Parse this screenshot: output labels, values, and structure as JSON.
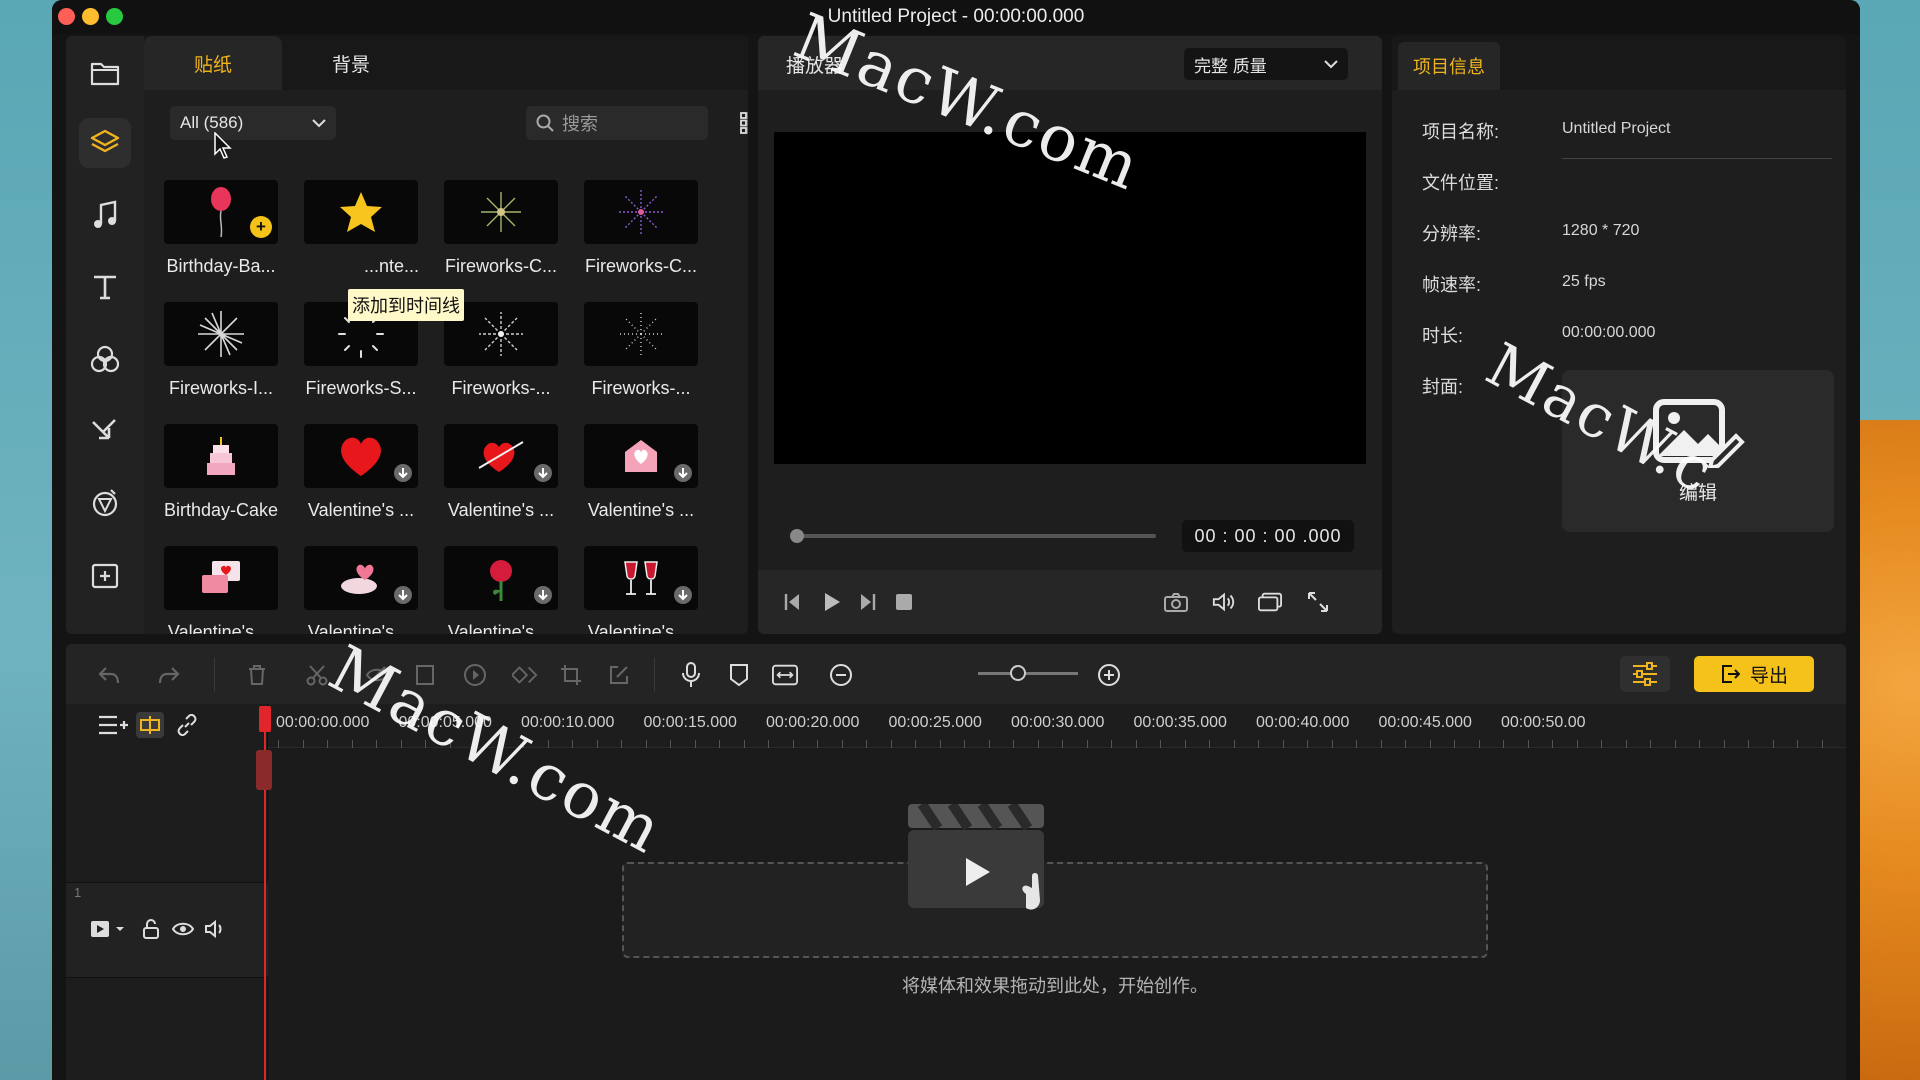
{
  "window": {
    "title": "Untitled Project - 00:00:00.000"
  },
  "sticker_panel": {
    "tabs": [
      {
        "label": "贴纸",
        "active": true
      },
      {
        "label": "背景",
        "active": false
      }
    ],
    "filter_value": "All (586)",
    "search_placeholder": "搜索",
    "tooltip": "添加到时间线",
    "items": [
      {
        "label": "Birthday-Ba...",
        "icon": "balloon",
        "badge": "add"
      },
      {
        "label": "...nte...",
        "icon": "star",
        "badge": ""
      },
      {
        "label": "Fireworks-C...",
        "icon": "firework-green",
        "badge": ""
      },
      {
        "label": "Fireworks-C...",
        "icon": "firework-purple",
        "badge": ""
      },
      {
        "label": "Fireworks-I...",
        "icon": "firework-white",
        "badge": ""
      },
      {
        "label": "Fireworks-S...",
        "icon": "firework-sparse",
        "badge": ""
      },
      {
        "label": "Fireworks-...",
        "icon": "firework-white",
        "badge": ""
      },
      {
        "label": "Fireworks-...",
        "icon": "firework-white",
        "badge": ""
      },
      {
        "label": "Birthday-Cake",
        "icon": "cake",
        "badge": ""
      },
      {
        "label": "Valentine's ...",
        "icon": "heart",
        "badge": "download"
      },
      {
        "label": "Valentine's ...",
        "icon": "heart-arrow",
        "badge": "download"
      },
      {
        "label": "Valentine's ...",
        "icon": "envelope-heart",
        "badge": "download"
      },
      {
        "label": "Valentine's ...",
        "icon": "love-cards",
        "badge": ""
      },
      {
        "label": "Valentine's ...",
        "icon": "cloud-heart",
        "badge": "download"
      },
      {
        "label": "Valentine's ...",
        "icon": "rose",
        "badge": "download"
      },
      {
        "label": "Valentine's ...",
        "icon": "wine-glasses",
        "badge": "download"
      }
    ]
  },
  "player": {
    "title": "播放器",
    "quality": "完整 质量",
    "timecode": "00 : 00 : 00 .000",
    "progress": 0
  },
  "project_info": {
    "tab": "项目信息",
    "rows": [
      {
        "label": "项目名称:",
        "value": "Untitled Project"
      },
      {
        "label": "文件位置:",
        "value": ""
      },
      {
        "label": "分辨率:",
        "value": "1280 * 720"
      },
      {
        "label": "帧速率:",
        "value": "25 fps"
      },
      {
        "label": "时长:",
        "value": "00:00:00.000"
      },
      {
        "label": "封面:",
        "value": ""
      }
    ],
    "cover_edit": "编辑"
  },
  "timeline": {
    "export_label": "导出",
    "ruler": [
      "00:00:00.000",
      "00:00:05.000",
      "00:00:10.000",
      "00:00:15.000",
      "00:00:20.000",
      "00:00:25.000",
      "00:00:30.000",
      "00:00:35.000",
      "00:00:40.000",
      "00:00:45.000",
      "00:00:50.00"
    ],
    "track_number": "1",
    "drop_hint": "将媒体和效果拖动到此处，开始创作。",
    "zoom_level": 0.4
  },
  "watermarks": [
    "MacW.com",
    "MacW.com",
    "MacW.c"
  ],
  "colors": {
    "accent": "#f0b41e",
    "export": "#f5c21a",
    "playhead": "#e0262a"
  }
}
